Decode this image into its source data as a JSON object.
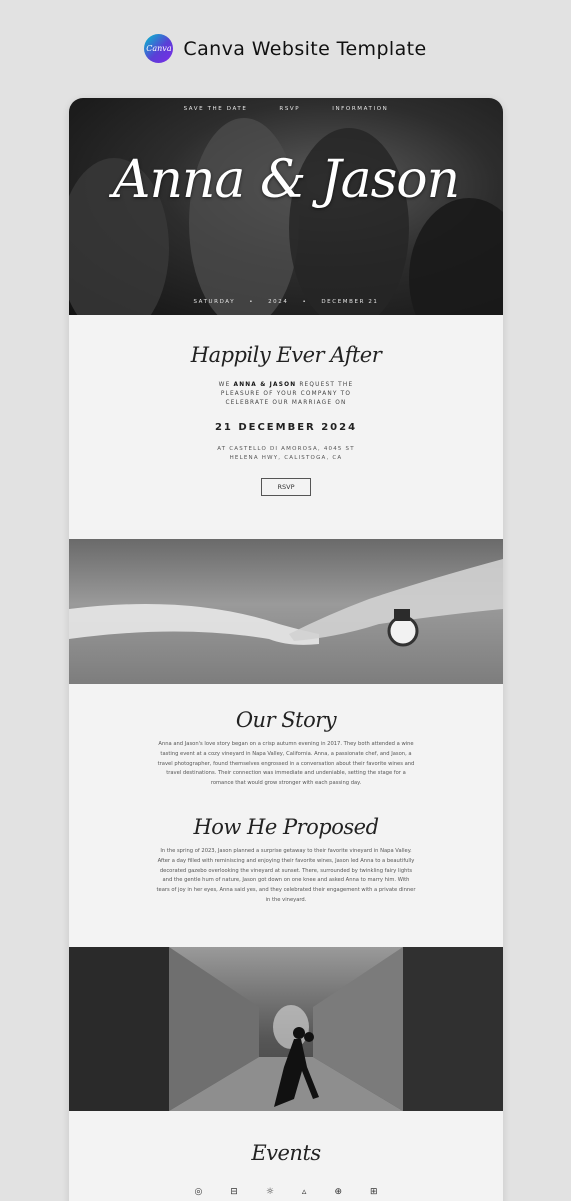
{
  "brand": {
    "logo_text": "Canva",
    "title": "Canva Website Template"
  },
  "nav": [
    "SAVE THE DATE",
    "RSVP",
    "INFORMATION"
  ],
  "hero": {
    "names": "Anna & Jason",
    "date_parts": [
      "SATURDAY",
      "•",
      "2024",
      "•",
      "DECEMBER 21"
    ]
  },
  "invite": {
    "heading": "Happily Ever After",
    "line1_pre": "WE ",
    "line1_names": "ANNA & JASON",
    "line1_post": " REQUEST THE",
    "line2": "PLEASURE OF YOUR COMPANY TO",
    "line3": "CELEBRATE OUR MARRIAGE ON",
    "date": "21 DECEMBER 2024",
    "venue1": "AT CASTELLO DI AMOROSA, 4045 ST",
    "venue2": "HELENA HWY, CALISTOGA, CA",
    "rsvp_label": "RSVP"
  },
  "story": {
    "heading": "Our Story",
    "text": "Anna and Jason's love story began on a crisp autumn evening in 2017. They both attended a wine tasting event at a cozy vineyard in Napa Valley, California. Anna, a passionate chef, and Jason, a travel photographer, found themselves engrossed in a conversation about their favorite wines and travel destinations. Their connection was immediate and undeniable, setting the stage for a romance that would grow stronger with each passing day.",
    "proposal_heading": "How He Proposed",
    "proposal_text": "In the spring of 2023, Jason planned a surprise getaway to their favorite vineyard in Napa Valley. After a day filled with reminiscing and enjoying their favorite wines, Jason led Anna to a beautifully decorated gazebo overlooking the vineyard at sunset. There, surrounded by twinkling fairy lights and the gentle hum of nature, Jason got down on one knee and asked Anna to marry him. With tears of joy in her eyes, Anna said yes, and they celebrated their engagement with a private dinner in the vineyard."
  },
  "events": {
    "heading": "Events",
    "icons": [
      "rings-icon",
      "car-icon",
      "sun-icon",
      "chat-icon",
      "leaf-icon",
      "cake-icon"
    ]
  },
  "colors": {
    "hero_bg": "#2d2d2d",
    "page_bg": "#e2e2e2",
    "section_bg": "#f3f3f3",
    "accent": "#7d2ae8"
  }
}
